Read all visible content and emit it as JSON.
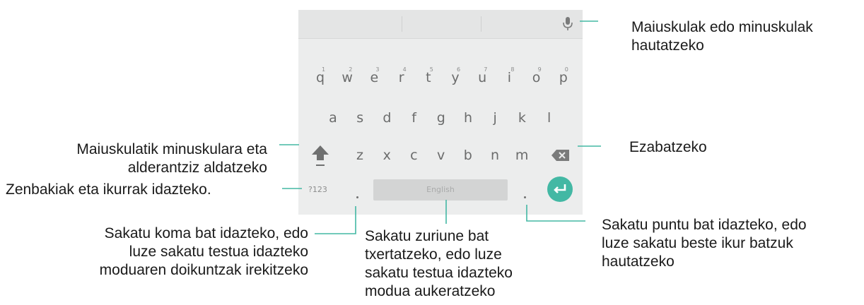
{
  "colors": {
    "keyboard_bg": "#eceded",
    "suggestion_bar_bg": "#e4e5e5",
    "key_text": "#6b6c6c",
    "enter_key": "#43b8a4",
    "callout_line": "#43b8a4"
  },
  "keyboard": {
    "row1": [
      {
        "key": "q",
        "num": "1"
      },
      {
        "key": "w",
        "num": "2"
      },
      {
        "key": "e",
        "num": "3"
      },
      {
        "key": "r",
        "num": "4"
      },
      {
        "key": "t",
        "num": "5"
      },
      {
        "key": "y",
        "num": "6"
      },
      {
        "key": "u",
        "num": "7"
      },
      {
        "key": "i",
        "num": "8"
      },
      {
        "key": "o",
        "num": "9"
      },
      {
        "key": "p",
        "num": "0"
      }
    ],
    "row2": [
      "a",
      "s",
      "d",
      "f",
      "g",
      "h",
      "j",
      "k",
      "l"
    ],
    "row3": [
      "z",
      "x",
      "c",
      "v",
      "b",
      "n",
      "m"
    ],
    "symbols_key": "?123",
    "space_label": "English",
    "icons": {
      "mic": "microphone-icon",
      "shift": "shift-arrow-icon",
      "backspace": "backspace-icon",
      "enter": "enter-arrow-icon"
    }
  },
  "callouts": {
    "mic": [
      "Maiuskulak edo minuskulak",
      "hautatzeko"
    ],
    "shift": [
      "Maiuskulatik minuskulara eta",
      "alderantziz aldatzeko"
    ],
    "backspace": [
      "Ezabatzeko"
    ],
    "symbols": [
      "Zenbakiak eta ikurrak idazteko."
    ],
    "comma": [
      "Sakatu koma bat idazteko, edo",
      "luze sakatu testua idazteko",
      "moduaren doikuntzak irekitzeko"
    ],
    "space": [
      "Sakatu zuriune bat",
      "txertatzeko, edo luze",
      "sakatu testua idazteko",
      "modua aukeratzeko"
    ],
    "period": [
      "Sakatu puntu bat idazteko, edo",
      "luze sakatu beste ikur batzuk",
      "hautatzeko"
    ]
  }
}
